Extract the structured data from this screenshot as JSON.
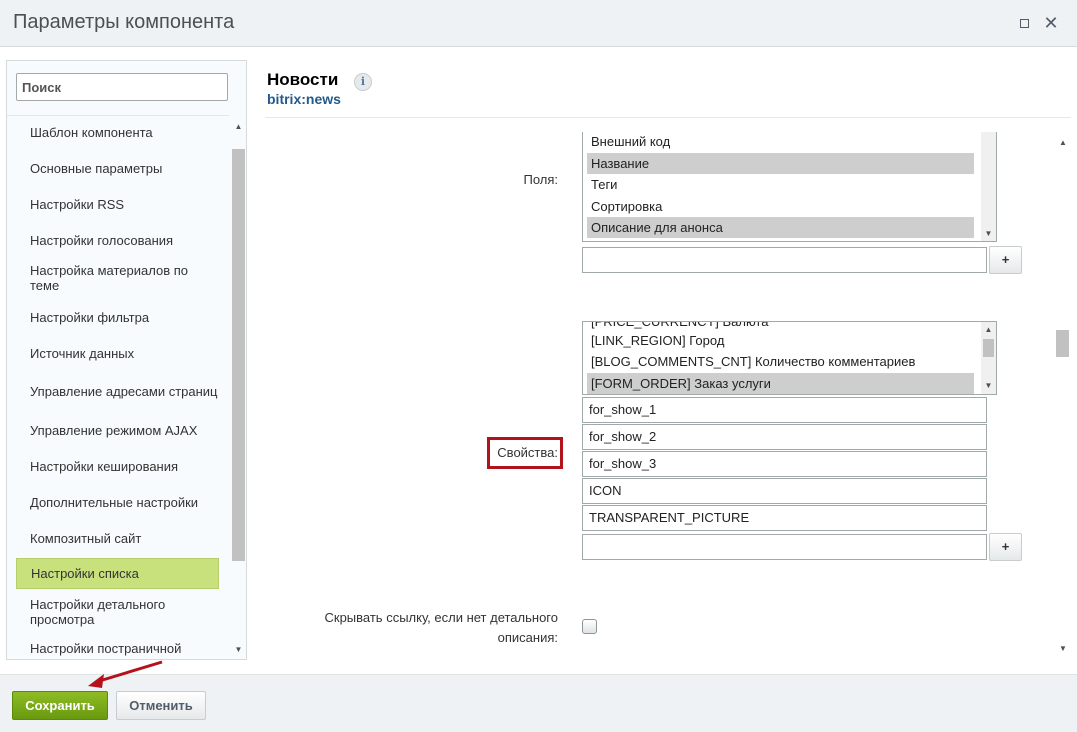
{
  "window": {
    "title": "Параметры компонента"
  },
  "sidebar": {
    "search_placeholder": "Поиск",
    "items": [
      {
        "label": "Шаблон компонента"
      },
      {
        "label": "Основные параметры"
      },
      {
        "label": "Настройки RSS"
      },
      {
        "label": "Настройки голосования"
      },
      {
        "label": "Настройка материалов по теме"
      },
      {
        "label": "Настройки фильтра"
      },
      {
        "label": "Источник данных"
      },
      {
        "label": "Управление адресами страниц"
      },
      {
        "label": "Управление режимом AJAX"
      },
      {
        "label": "Настройки кеширования"
      },
      {
        "label": "Дополнительные настройки"
      },
      {
        "label": "Композитный сайт"
      },
      {
        "label": "Настройки списка",
        "active": true
      },
      {
        "label": "Настройки детального просмотра"
      },
      {
        "label": "Настройки постраничной"
      }
    ]
  },
  "header": {
    "title": "Новости",
    "subtitle": "bitrix:news",
    "info_glyph": "i"
  },
  "fields": {
    "label": "Поля:",
    "options": [
      {
        "text": "Внешний код",
        "selected": false
      },
      {
        "text": "Название",
        "selected": true
      },
      {
        "text": "Теги",
        "selected": false
      },
      {
        "text": "Сортировка",
        "selected": false
      },
      {
        "text": "Описание для анонса",
        "selected": true
      }
    ],
    "input_value": "",
    "add_label": "+"
  },
  "properties": {
    "label": "Свойства:",
    "options": [
      {
        "text": "[PRICE_CURRENCY] Валюта",
        "selected": false
      },
      {
        "text": "[LINK_REGION] Город",
        "selected": false
      },
      {
        "text": "[BLOG_COMMENTS_CNT] Количество комментариев",
        "selected": false
      },
      {
        "text": "[FORM_ORDER] Заказ услуги",
        "selected": true
      }
    ],
    "inputs": [
      "for_show_1",
      "for_show_2",
      "for_show_3",
      "ICON",
      "TRANSPARENT_PICTURE"
    ],
    "empty_input_value": "",
    "add_label": "+"
  },
  "hide_link": {
    "label_line1": "Скрывать ссылку, если нет детального",
    "label_line2": "описания:",
    "checked": false
  },
  "footer": {
    "save_label": "Сохранить",
    "cancel_label": "Отменить"
  },
  "icons": {
    "close": "close-icon",
    "maximize": "maximize-icon",
    "info": "info-icon"
  },
  "colors": {
    "save_button": "#6e9f13",
    "active_item": "#c9e17c",
    "annotation": "#b3121c",
    "subtitle": "#245a8a"
  }
}
